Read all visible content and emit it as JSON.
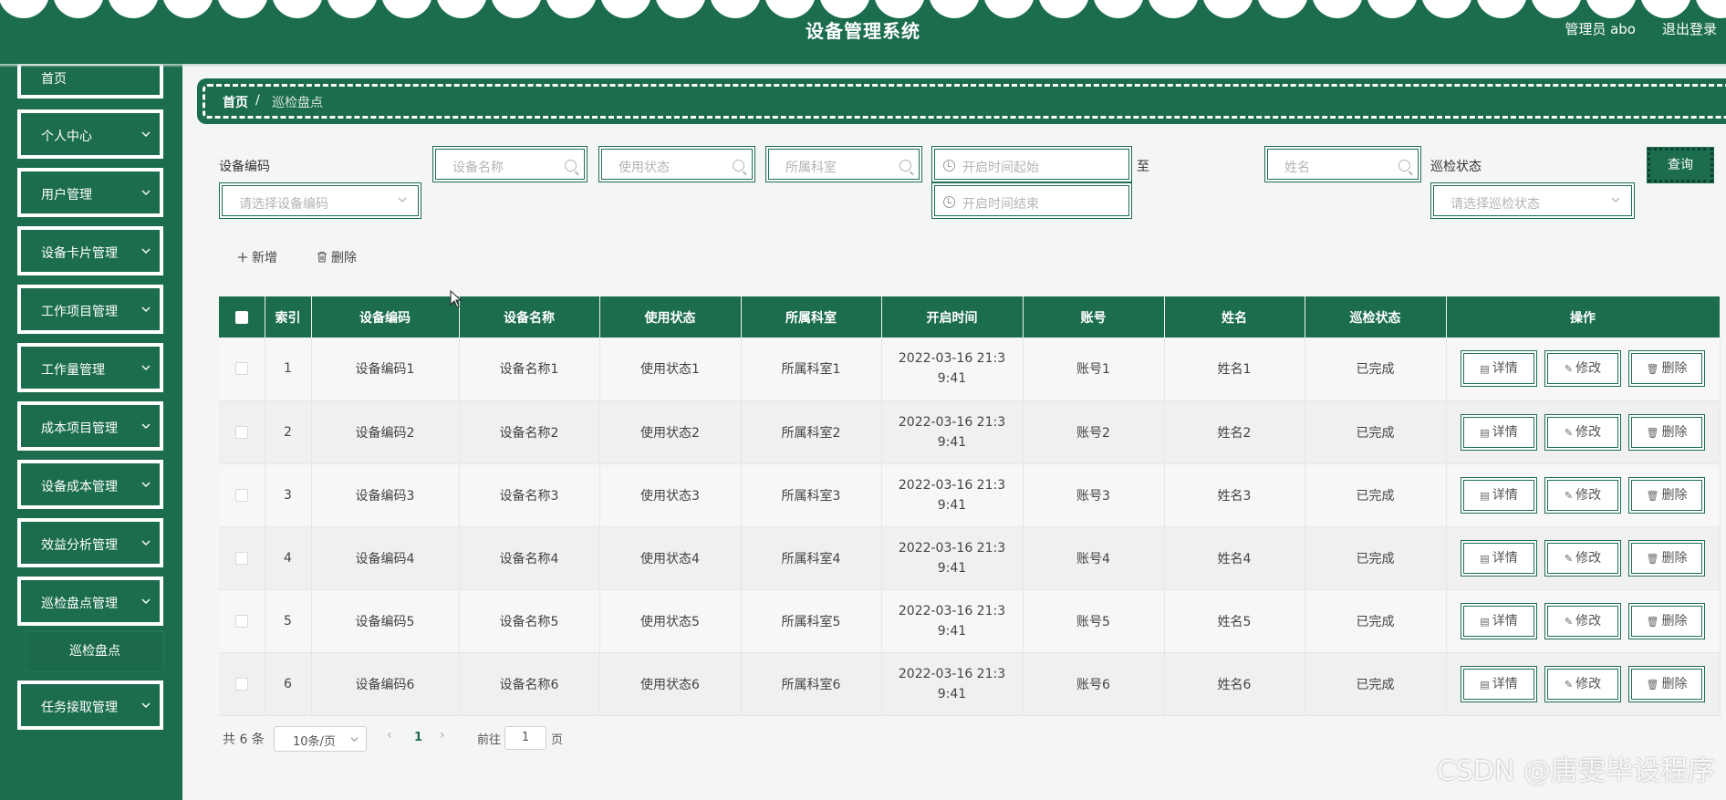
{
  "header": {
    "title": "设备管理系统",
    "user": "管理员 abo",
    "logout": "退出登录"
  },
  "sidebar": {
    "items": [
      {
        "label": "首页"
      },
      {
        "label": "个人中心"
      },
      {
        "label": "用户管理"
      },
      {
        "label": "设备卡片管理"
      },
      {
        "label": "工作项目管理"
      },
      {
        "label": "工作量管理"
      },
      {
        "label": "成本项目管理"
      },
      {
        "label": "设备成本管理"
      },
      {
        "label": "效益分析管理"
      },
      {
        "label": "巡检盘点管理"
      },
      {
        "label": "任务接取管理"
      }
    ],
    "sub_item": "巡检盘点"
  },
  "breadcrumb": {
    "home": "首页",
    "sep": "/",
    "current": "巡检盘点"
  },
  "filters": {
    "code_label": "设备编码",
    "code_placeholder": "请选择设备编码",
    "name_placeholder": "设备名称",
    "status_placeholder": "使用状态",
    "dept_placeholder": "所属科室",
    "start_placeholder": "开启时间起始",
    "to_label": "至",
    "end_placeholder": "开启时间结束",
    "person_placeholder": "姓名",
    "inspect_label": "巡检状态",
    "inspect_placeholder": "请选择巡检状态",
    "query": "查询"
  },
  "toolbar": {
    "add": "新增",
    "delete": "删除"
  },
  "table": {
    "columns": [
      "索引",
      "设备编码",
      "设备名称",
      "使用状态",
      "所属科室",
      "开启时间",
      "账号",
      "姓名",
      "巡检状态",
      "操作"
    ],
    "rows": [
      {
        "index": "1",
        "code": "设备编码1",
        "name": "设备名称1",
        "status": "使用状态1",
        "dept": "所属科室1",
        "time": "2022-03-16 21:39:41",
        "account": "账号1",
        "person": "姓名1",
        "inspect": "已完成"
      },
      {
        "index": "2",
        "code": "设备编码2",
        "name": "设备名称2",
        "status": "使用状态2",
        "dept": "所属科室2",
        "time": "2022-03-16 21:39:41",
        "account": "账号2",
        "person": "姓名2",
        "inspect": "已完成"
      },
      {
        "index": "3",
        "code": "设备编码3",
        "name": "设备名称3",
        "status": "使用状态3",
        "dept": "所属科室3",
        "time": "2022-03-16 21:39:41",
        "account": "账号3",
        "person": "姓名3",
        "inspect": "已完成"
      },
      {
        "index": "4",
        "code": "设备编码4",
        "name": "设备名称4",
        "status": "使用状态4",
        "dept": "所属科室4",
        "time": "2022-03-16 21:39:41",
        "account": "账号4",
        "person": "姓名4",
        "inspect": "已完成"
      },
      {
        "index": "5",
        "code": "设备编码5",
        "name": "设备名称5",
        "status": "使用状态5",
        "dept": "所属科室5",
        "time": "2022-03-16 21:39:41",
        "account": "账号5",
        "person": "姓名5",
        "inspect": "已完成"
      },
      {
        "index": "6",
        "code": "设备编码6",
        "name": "设备名称6",
        "status": "使用状态6",
        "dept": "所属科室6",
        "time": "2022-03-16 21:39:41",
        "account": "账号6",
        "person": "姓名6",
        "inspect": "已完成"
      }
    ],
    "actions": {
      "detail": "详情",
      "edit": "修改",
      "delete": "删除"
    }
  },
  "pagination": {
    "total": "共 6 条",
    "page_size": "10条/页",
    "current_page": "1",
    "goto": "前往",
    "goto_value": "1",
    "unit": "页"
  },
  "watermark": "CSDN @唐雯毕设程序",
  "colors": {
    "brand": "#1b6d4e",
    "background": "#f4f5f5"
  },
  "icons": {
    "search": "search-icon",
    "clock": "clock-icon",
    "chevron": "chevron-down-icon",
    "add": "plus-icon",
    "trash": "trash-icon",
    "doc": "document-icon",
    "edit": "pencil-icon"
  }
}
